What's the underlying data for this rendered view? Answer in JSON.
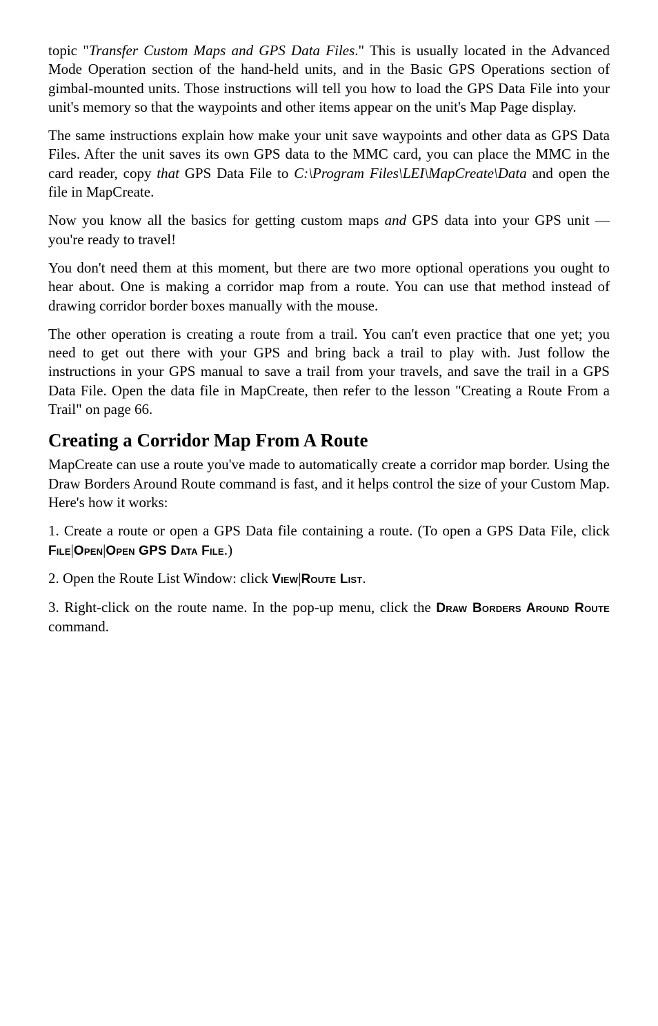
{
  "p1a": "topic \"",
  "p1b": "Transfer Custom Maps and GPS Data Files",
  "p1c": ".\" This is usually located in the Advanced Mode Operation section of the hand-held units, and in the Basic GPS Operations section of gimbal-mounted units. Those instructions will tell you how to load the GPS Data File into your unit's memory so that the waypoints and other items appear on the unit's Map Page display.",
  "p2a": "The same instructions explain how make your unit save waypoints and other data as GPS Data Files. After the unit saves its own GPS data to the MMC card, you can place the MMC in the card reader, copy ",
  "p2b": "that",
  "p2c": " GPS Data File to ",
  "p2d": "C:\\Program Files\\LEI\\MapCreate\\Data",
  "p2e": " and open the file in MapCreate.",
  "p3a": "Now you know all the basics for getting custom maps ",
  "p3b": "and",
  "p3c": " GPS data into your GPS unit — you're ready to travel!",
  "p4": "You don't need them at this moment, but there are two more optional operations you ought to hear about. One is making a corridor map from a route. You can use that method instead of drawing corridor border boxes manually with the mouse.",
  "p5": "The other operation is creating a route from a trail. You can't even practice that one yet; you need to get out there with your GPS and bring back a trail to play with. Just follow the instructions in your GPS manual to save a trail from your travels, and save the trail in a GPS Data File. Open the data file in MapCreate, then refer to the lesson \"Creating a Route From a Trail\" on page 66.",
  "h2": "Creating a Corridor Map From A Route",
  "p6": "MapCreate can use a route you've made to automatically create a corridor map border. Using the Draw Borders Around Route command is fast, and it helps control the size of your Custom Map. Here's how it works:",
  "p7a": "1. Create a route or open a GPS Data file containing a route. (To open a GPS Data File, click ",
  "p7b": "File",
  "p7c": "|",
  "p7d": "Open",
  "p7e": "|",
  "p7f": "Open GPS Data File",
  "p7g": ".)",
  "p8a": "2. Open the Route List Window: click ",
  "p8b": "View",
  "p8c": "|",
  "p8d": "Route List",
  "p8e": ".",
  "p9a": "3. Right-click on the route name. In the pop-up menu, click the ",
  "p9b": "Draw Borders Around Route",
  "p9c": " command."
}
